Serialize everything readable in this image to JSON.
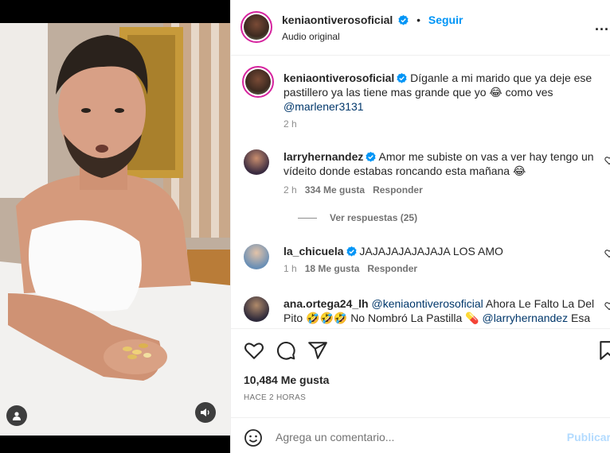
{
  "post": {
    "author": "keniaontiverosoficial",
    "follow_label": "Seguir",
    "audio": "Audio original",
    "more_label": "...",
    "caption": {
      "author": "keniaontiverosoficial",
      "text": "Díganle a mi marido que ya deje ese pastillero ya las tiene mas grande que yo 😂 como ves",
      "mention": "@marlener3131",
      "time": "2 h"
    }
  },
  "comments": [
    {
      "author": "larryhernandez",
      "verified": true,
      "text": "Amor me subiste on vas a ver hay tengo un vídeito donde estabas roncando esta mañana 😂",
      "time": "2 h",
      "likes": "334 Me gusta",
      "reply": "Responder",
      "view_replies": "Ver respuestas (25)"
    },
    {
      "author": "la_chicuela",
      "verified": true,
      "text": "JAJAJAJAJAJAJA LOS AMO",
      "time": "1 h",
      "likes": "18 Me gusta",
      "reply": "Responder"
    },
    {
      "author": "ana.ortega24_lh",
      "verified": false,
      "mention1": "@keniaontiverosoficial",
      "text1": " Ahora Le Falto La Del Pito 🤣🤣🤣 No Nombró La Pastilla 💊 ",
      "mention2": "@larryhernandez",
      "text2": " Esa"
    }
  ],
  "footer": {
    "likes": "10,484 Me gusta",
    "time": "HACE 2 HORAS",
    "comment_placeholder": "Agrega un comentario...",
    "publish_label": "Publicar"
  },
  "icons": [
    "heart-icon",
    "comment-icon",
    "share-icon",
    "bookmark-icon",
    "emoji-icon",
    "sound-icon",
    "user-tag-icon",
    "verified-icon",
    "more-icon"
  ],
  "colors": {
    "link": "#0095f6",
    "mention": "#00376b",
    "verified": "#0095f6",
    "muted": "#737373"
  }
}
